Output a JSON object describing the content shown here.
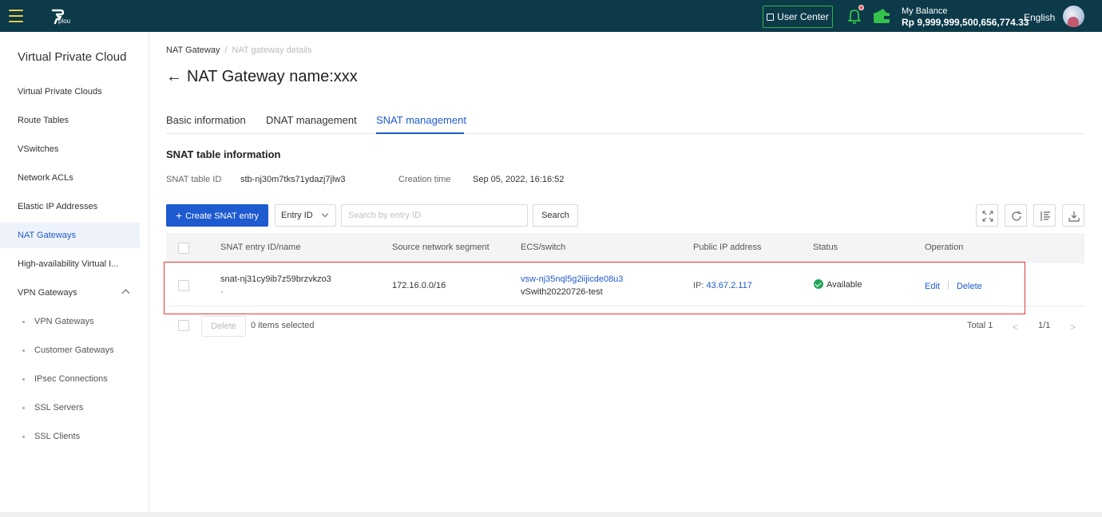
{
  "header": {
    "logo_sub": "plou",
    "user_center": "User Center",
    "balance_label": "My Balance",
    "balance_value": "Rp 9,999,999,500,656,774.33",
    "language": "English"
  },
  "sidebar": {
    "title": "Virtual Private Cloud",
    "items": [
      {
        "label": "Virtual Private Clouds"
      },
      {
        "label": "Route Tables"
      },
      {
        "label": "VSwitches"
      },
      {
        "label": "Network ACLs"
      },
      {
        "label": "Elastic IP Addresses"
      },
      {
        "label": "NAT Gateways"
      },
      {
        "label": "High-availability Virtual I..."
      },
      {
        "label": "VPN Gateways"
      }
    ],
    "sub_items": [
      {
        "label": "VPN Gateways"
      },
      {
        "label": "Customer Gateways"
      },
      {
        "label": "IPsec Connections"
      },
      {
        "label": "SSL Servers"
      },
      {
        "label": "SSL Clients"
      }
    ]
  },
  "breadcrumb": {
    "root": "NAT Gateway",
    "separator": "/",
    "current": "NAT gateway details"
  },
  "page": {
    "back": "←",
    "title": "NAT Gateway name:xxx"
  },
  "tabs": [
    {
      "label": "Basic information"
    },
    {
      "label": "DNAT management"
    },
    {
      "label": "SNAT management"
    }
  ],
  "section": {
    "title": "SNAT table information",
    "table_id_label": "SNAT table ID",
    "table_id_value": "stb-nj30m7tks71ydazj7jlw3",
    "creation_label": "Creation time",
    "creation_value": "Sep 05, 2022, 16:16:52"
  },
  "toolbar": {
    "create_label": "Create SNAT entry",
    "filter_selected": "Entry ID",
    "search_placeholder": "Search by entry ID",
    "search_label": "Search"
  },
  "table": {
    "columns": [
      "SNAT entry ID/name",
      "Source network segment",
      "ECS/switch",
      "Public IP address",
      "Status",
      "Operation"
    ],
    "rows": [
      {
        "entry_id": "snat-nj31cy9ib7z59brzvkzo3",
        "entry_name": "-",
        "source_segment": "172.16.0.0/16",
        "switch_id": "vsw-nj35nql5g2iijicde08u3",
        "switch_name": "vSwith20220726-test",
        "ip_label": "IP:",
        "ip_value": "43.67.2.117",
        "status": "Available",
        "edit": "Edit",
        "delete": "Delete"
      }
    ]
  },
  "footer": {
    "delete_label": "Delete",
    "selected_text": "0 items selected",
    "total": "Total 1",
    "page": "1/1"
  },
  "colors": {
    "topbar": "#0c3a49",
    "accent": "#1e5ad0",
    "highlight": "#e23b3b",
    "status_ok": "#22a35a"
  }
}
